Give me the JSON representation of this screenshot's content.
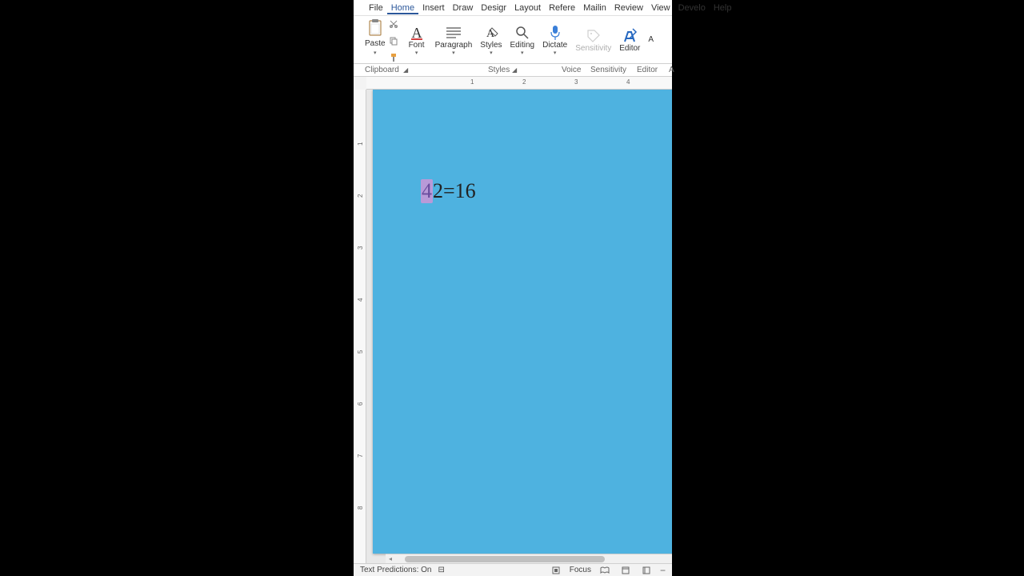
{
  "menu": {
    "file": "File",
    "home": "Home",
    "insert": "Insert",
    "draw": "Draw",
    "design": "Desigr",
    "layout": "Layout",
    "references": "Refere",
    "mailings": "Mailin",
    "review": "Review",
    "view": "View",
    "developer": "Develo",
    "help": "Help"
  },
  "ribbon": {
    "paste": "Paste",
    "font": "Font",
    "paragraph": "Paragraph",
    "styles": "Styles",
    "editing": "Editing",
    "dictate": "Dictate",
    "sensitivity": "Sensitivity",
    "editor": "Editor",
    "a": "A"
  },
  "groups": {
    "clipboard": "Clipboard",
    "styles": "Styles",
    "voice": "Voice",
    "sensitivity": "Sensitivity",
    "editor": "Editor",
    "a": "A"
  },
  "ruler": {
    "h": [
      "1",
      "2",
      "3",
      "4"
    ],
    "v": [
      "1",
      "2",
      "3",
      "4",
      "5",
      "6",
      "7",
      "8"
    ]
  },
  "document": {
    "equation": {
      "base": "4",
      "exponent": "2",
      "operator": " = ",
      "result": "16"
    }
  },
  "statusbar": {
    "text_predictions": "Text Predictions: On",
    "focus": "Focus"
  }
}
